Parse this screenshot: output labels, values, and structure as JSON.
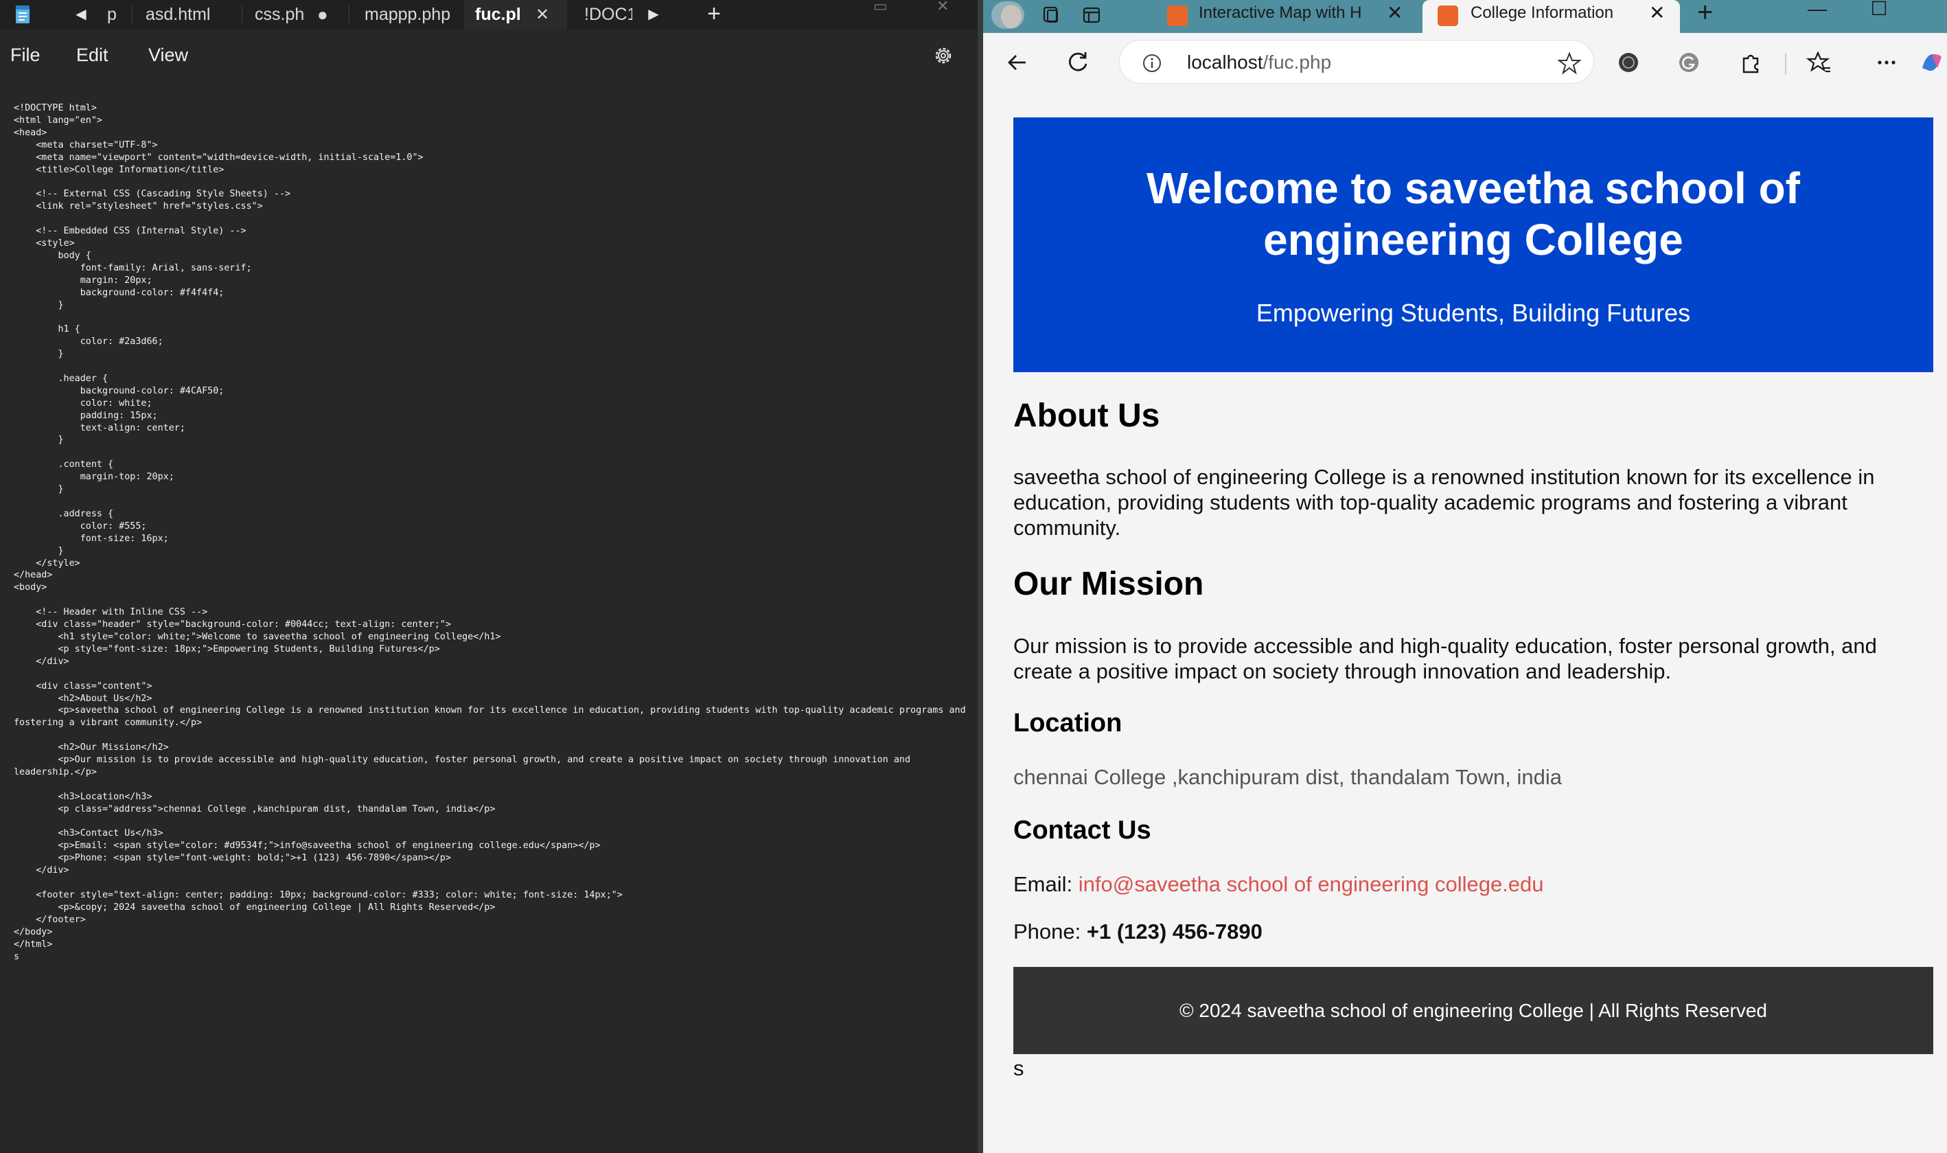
{
  "notepad": {
    "tabs": [
      {
        "label": "p"
      },
      {
        "label": "asd.html"
      },
      {
        "label": "css.ph|"
      },
      {
        "label": "mappp.php"
      },
      {
        "label": "fuc.pl"
      },
      {
        "label": "!DOC1"
      }
    ],
    "unsaved_indicator": "●",
    "active_close": "✕",
    "menu": {
      "file": "File",
      "edit": "Edit",
      "view": "View"
    },
    "code": "<!DOCTYPE html>\n<html lang=\"en\">\n<head>\n    <meta charset=\"UTF-8\">\n    <meta name=\"viewport\" content=\"width=device-width, initial-scale=1.0\">\n    <title>College Information</title>\n\n    <!-- External CSS (Cascading Style Sheets) -->\n    <link rel=\"stylesheet\" href=\"styles.css\">\n\n    <!-- Embedded CSS (Internal Style) -->\n    <style>\n        body {\n            font-family: Arial, sans-serif;\n            margin: 20px;\n            background-color: #f4f4f4;\n        }\n\n        h1 {\n            color: #2a3d66;\n        }\n\n        .header {\n            background-color: #4CAF50;\n            color: white;\n            padding: 15px;\n            text-align: center;\n        }\n\n        .content {\n            margin-top: 20px;\n        }\n\n        .address {\n            color: #555;\n            font-size: 16px;\n        }\n    </style>\n</head>\n<body>\n\n    <!-- Header with Inline CSS -->\n    <div class=\"header\" style=\"background-color: #0044cc; text-align: center;\">\n        <h1 style=\"color: white;\">Welcome to saveetha school of engineering College</h1>\n        <p style=\"font-size: 18px;\">Empowering Students, Building Futures</p>\n    </div>\n\n    <div class=\"content\">\n        <h2>About Us</h2>\n        <p>saveetha school of engineering College is a renowned institution known for its excellence in education, providing students with top-quality academic programs and\nfostering a vibrant community.</p>\n\n        <h2>Our Mission</h2>\n        <p>Our mission is to provide accessible and high-quality education, foster personal growth, and create a positive impact on society through innovation and\nleadership.</p>\n\n        <h3>Location</h3>\n        <p class=\"address\">chennai College ,kanchipuram dist, thandalam Town, india</p>\n\n        <h3>Contact Us</h3>\n        <p>Email: <span style=\"color: #d9534f;\">info@saveetha school of engineering college.edu</span></p>\n        <p>Phone: <span style=\"font-weight: bold;\">+1 (123) 456-7890</span></p>\n    </div>\n\n    <footer style=\"text-align: center; padding: 10px; background-color: #333; color: white; font-size: 14px;\">\n        <p>&copy; 2024 saveetha school of engineering College | All Rights Reserved</p>\n    </footer>\n</body>\n</html>\ns"
  },
  "browser": {
    "tabs": [
      {
        "title": "Interactive Map with H"
      },
      {
        "title": "College Information"
      }
    ],
    "tab_close": "✕",
    "new_tab": "+",
    "url_host": "localhost",
    "url_path": "/fuc.php",
    "win_min": "—",
    "win_max": "☐"
  },
  "page": {
    "header_title": "Welcome to saveetha school of engineering College",
    "header_subtitle": "Empowering Students, Building Futures",
    "about_heading": "About Us",
    "about_text": "saveetha school of engineering College is a renowned institution known for its excellence in education, providing students with top-quality academic programs and fostering a vibrant community.",
    "mission_heading": "Our Mission",
    "mission_text": "Our mission is to provide accessible and high-quality education, foster personal growth, and create a positive impact on society through innovation and leadership.",
    "location_heading": "Location",
    "address": "chennai College ,kanchipuram dist, thandalam Town, india",
    "contact_heading": "Contact Us",
    "email_label": "Email: ",
    "email": "info@saveetha school of engineering college.edu",
    "phone_label": "Phone: ",
    "phone": "+1 (123) 456-7890",
    "footer": "© 2024 saveetha school of engineering College | All Rights Reserved",
    "stray_text": "s"
  },
  "colors": {
    "header_bg": "#0044cc",
    "email": "#d9534f",
    "address": "#555555",
    "footer_bg": "#333333",
    "browser_tabstrip": "#4f8e9e",
    "editor_bg": "#272727"
  }
}
